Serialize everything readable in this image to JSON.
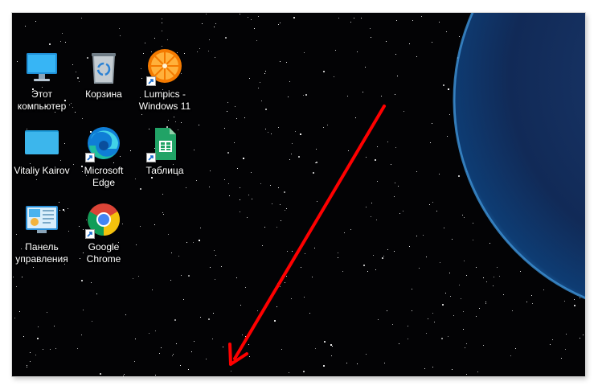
{
  "desktop": {
    "icons": [
      {
        "label": "Этот\nкомпьютер",
        "icon": "this-pc-icon"
      },
      {
        "label": "Корзина",
        "icon": "recycle-bin-icon"
      },
      {
        "label": "Lumpics -\nWindows 11",
        "icon": "lumpics-orange-icon"
      },
      {
        "label": "Vitaliy Kairov",
        "icon": "user-folder-icon"
      },
      {
        "label": "Microsoft\nEdge",
        "icon": "edge-icon"
      },
      {
        "label": "Таблица",
        "icon": "sheets-icon"
      },
      {
        "label": "Панель\nуправления",
        "icon": "control-panel-icon"
      },
      {
        "label": "Google\nChrome",
        "icon": "chrome-icon"
      }
    ]
  },
  "annotation": {
    "type": "red-arrow",
    "color": "#ff0000"
  }
}
